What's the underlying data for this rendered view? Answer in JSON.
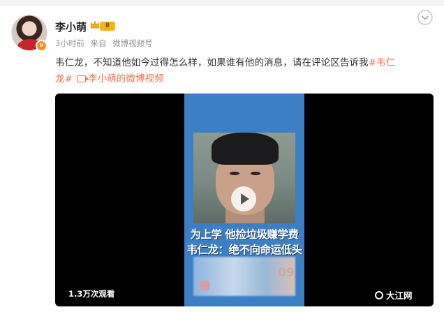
{
  "post": {
    "author": "李小萌",
    "level": "Ⅱ",
    "verified_mark": "v",
    "time": "3小时前",
    "source_prefix": "来自",
    "source": "微博视频号",
    "text": "韦仁龙，不知道他如今过得怎么样，如果谁有他的消息，请在评论区告诉我",
    "hashtag_part1": "#韦仁",
    "hashtag_part2": "龙#",
    "video_link": "李小萌的微博视频"
  },
  "video": {
    "caption_line1": "为上学 他捡垃圾赚学费",
    "caption_line2": "韦仁龙：绝不向命运低头",
    "view_count": "1.3万次观看",
    "blur_number": "09"
  },
  "watermark": "大江网",
  "colors": {
    "link": "#eb7350",
    "video_frame": "#3c7fc5",
    "level_badge": "#f3b21b"
  },
  "icons": [
    "crown-icon",
    "more-options-icon",
    "video-link-icon",
    "play-icon",
    "verified-badge-icon",
    "watermark-logo-icon"
  ]
}
